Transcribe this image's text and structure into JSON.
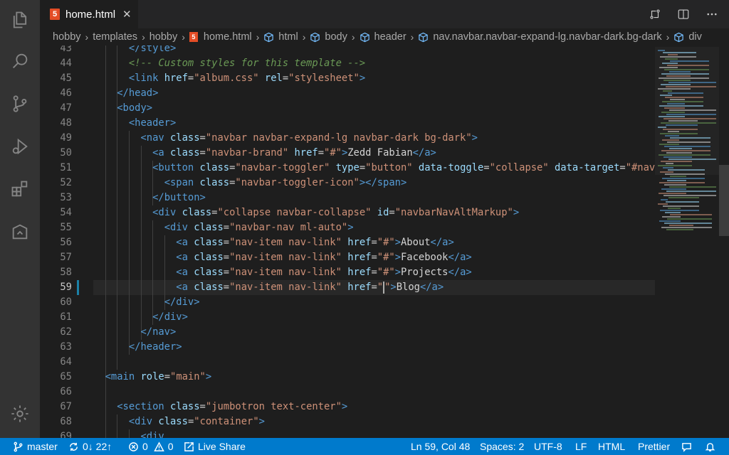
{
  "tab": {
    "icon_label": "5",
    "label": "home.html",
    "close": "✕"
  },
  "breadcrumb": {
    "items": [
      "hobby",
      "templates",
      "hobby",
      "home.html",
      "html",
      "body",
      "header",
      "nav.navbar.navbar-expand-lg.navbar-dark.bg-dark",
      "div"
    ],
    "separator": "›"
  },
  "activity_bar": {
    "items": [
      "explorer-icon",
      "search-icon",
      "source-control-icon",
      "run-debug-icon",
      "extensions-icon",
      "remote-explorer-icon"
    ],
    "bottom": "settings-gear-icon"
  },
  "editor": {
    "current_line": 59,
    "lines": [
      {
        "n": "43",
        "code": [
          [
            "x",
            "      "
          ],
          [
            "t",
            "</style>"
          ]
        ]
      },
      {
        "n": "44",
        "code": [
          [
            "x",
            "      "
          ],
          [
            "c",
            "<!-- Custom styles for this template -->"
          ]
        ]
      },
      {
        "n": "45",
        "code": [
          [
            "x",
            "      "
          ],
          [
            "t",
            "<link "
          ],
          [
            "a",
            "href"
          ],
          [
            "x",
            "="
          ],
          [
            "s",
            "\"album.css\""
          ],
          [
            "x",
            " "
          ],
          [
            "a",
            "rel"
          ],
          [
            "x",
            "="
          ],
          [
            "s",
            "\"stylesheet\""
          ],
          [
            "t",
            ">"
          ]
        ]
      },
      {
        "n": "46",
        "code": [
          [
            "x",
            "    "
          ],
          [
            "t",
            "</head>"
          ]
        ]
      },
      {
        "n": "47",
        "code": [
          [
            "x",
            "    "
          ],
          [
            "t",
            "<body>"
          ]
        ]
      },
      {
        "n": "48",
        "code": [
          [
            "x",
            "      "
          ],
          [
            "t",
            "<header>"
          ]
        ]
      },
      {
        "n": "49",
        "code": [
          [
            "x",
            "        "
          ],
          [
            "t",
            "<nav "
          ],
          [
            "a",
            "class"
          ],
          [
            "x",
            "="
          ],
          [
            "s",
            "\"navbar navbar-expand-lg navbar-dark bg-dark\""
          ],
          [
            "t",
            ">"
          ]
        ]
      },
      {
        "n": "50",
        "code": [
          [
            "x",
            "          "
          ],
          [
            "t",
            "<a "
          ],
          [
            "a",
            "class"
          ],
          [
            "x",
            "="
          ],
          [
            "s",
            "\"navbar-brand\""
          ],
          [
            "x",
            " "
          ],
          [
            "a",
            "href"
          ],
          [
            "x",
            "="
          ],
          [
            "s",
            "\"#\""
          ],
          [
            "t",
            ">"
          ],
          [
            "x",
            "Zedd Fabian"
          ],
          [
            "t",
            "</a>"
          ]
        ]
      },
      {
        "n": "51",
        "code": [
          [
            "x",
            "          "
          ],
          [
            "t",
            "<button "
          ],
          [
            "a",
            "class"
          ],
          [
            "x",
            "="
          ],
          [
            "s",
            "\"navbar-toggler\""
          ],
          [
            "x",
            " "
          ],
          [
            "a",
            "type"
          ],
          [
            "x",
            "="
          ],
          [
            "s",
            "\"button\""
          ],
          [
            "x",
            " "
          ],
          [
            "a",
            "data-toggle"
          ],
          [
            "x",
            "="
          ],
          [
            "s",
            "\"collapse\""
          ],
          [
            "x",
            " "
          ],
          [
            "a",
            "data-target"
          ],
          [
            "x",
            "="
          ],
          [
            "s",
            "\"#navba"
          ]
        ]
      },
      {
        "n": "52",
        "code": [
          [
            "x",
            "            "
          ],
          [
            "t",
            "<span "
          ],
          [
            "a",
            "class"
          ],
          [
            "x",
            "="
          ],
          [
            "s",
            "\"navbar-toggler-icon\""
          ],
          [
            "t",
            "></span>"
          ]
        ]
      },
      {
        "n": "53",
        "code": [
          [
            "x",
            "          "
          ],
          [
            "t",
            "</button>"
          ]
        ]
      },
      {
        "n": "54",
        "code": [
          [
            "x",
            "          "
          ],
          [
            "t",
            "<div "
          ],
          [
            "a",
            "class"
          ],
          [
            "x",
            "="
          ],
          [
            "s",
            "\"collapse navbar-collapse\""
          ],
          [
            "x",
            " "
          ],
          [
            "a",
            "id"
          ],
          [
            "x",
            "="
          ],
          [
            "s",
            "\"navbarNavAltMarkup\""
          ],
          [
            "t",
            ">"
          ]
        ]
      },
      {
        "n": "55",
        "code": [
          [
            "x",
            "            "
          ],
          [
            "t",
            "<div "
          ],
          [
            "a",
            "class"
          ],
          [
            "x",
            "="
          ],
          [
            "s",
            "\"navbar-nav ml-auto\""
          ],
          [
            "t",
            ">"
          ]
        ]
      },
      {
        "n": "56",
        "code": [
          [
            "x",
            "              "
          ],
          [
            "t",
            "<a "
          ],
          [
            "a",
            "class"
          ],
          [
            "x",
            "="
          ],
          [
            "s",
            "\"nav-item nav-link\""
          ],
          [
            "x",
            " "
          ],
          [
            "a",
            "href"
          ],
          [
            "x",
            "="
          ],
          [
            "s",
            "\"#\""
          ],
          [
            "t",
            ">"
          ],
          [
            "x",
            "About"
          ],
          [
            "t",
            "</a>"
          ]
        ]
      },
      {
        "n": "57",
        "code": [
          [
            "x",
            "              "
          ],
          [
            "t",
            "<a "
          ],
          [
            "a",
            "class"
          ],
          [
            "x",
            "="
          ],
          [
            "s",
            "\"nav-item nav-link\""
          ],
          [
            "x",
            " "
          ],
          [
            "a",
            "href"
          ],
          [
            "x",
            "="
          ],
          [
            "s",
            "\"#\""
          ],
          [
            "t",
            ">"
          ],
          [
            "x",
            "Facebook"
          ],
          [
            "t",
            "</a>"
          ]
        ]
      },
      {
        "n": "58",
        "code": [
          [
            "x",
            "              "
          ],
          [
            "t",
            "<a "
          ],
          [
            "a",
            "class"
          ],
          [
            "x",
            "="
          ],
          [
            "s",
            "\"nav-item nav-link\""
          ],
          [
            "x",
            " "
          ],
          [
            "a",
            "href"
          ],
          [
            "x",
            "="
          ],
          [
            "s",
            "\"#\""
          ],
          [
            "t",
            ">"
          ],
          [
            "x",
            "Projects"
          ],
          [
            "t",
            "</a>"
          ]
        ]
      },
      {
        "n": "59",
        "code": [
          [
            "x",
            "              "
          ],
          [
            "t",
            "<a "
          ],
          [
            "a",
            "class"
          ],
          [
            "x",
            "="
          ],
          [
            "s",
            "\""
          ],
          [
            "caret",
            ""
          ],
          [
            "s",
            "\""
          ],
          [
            "t",
            ">"
          ],
          [
            "x",
            "Blog"
          ],
          [
            "t",
            "</a>"
          ]
        ],
        "attr_prefix": "nav-item nav-link"
      },
      {
        "n": "60",
        "code": [
          [
            "x",
            "            "
          ],
          [
            "t",
            "</div>"
          ]
        ]
      },
      {
        "n": "61",
        "code": [
          [
            "x",
            "          "
          ],
          [
            "t",
            "</div>"
          ]
        ]
      },
      {
        "n": "62",
        "code": [
          [
            "x",
            "        "
          ],
          [
            "t",
            "</nav>"
          ]
        ]
      },
      {
        "n": "63",
        "code": [
          [
            "x",
            "      "
          ],
          [
            "t",
            "</header>"
          ]
        ]
      },
      {
        "n": "64",
        "code": []
      },
      {
        "n": "65",
        "code": [
          [
            "x",
            "  "
          ],
          [
            "t",
            "<main "
          ],
          [
            "a",
            "role"
          ],
          [
            "x",
            "="
          ],
          [
            "s",
            "\"main\""
          ],
          [
            "t",
            ">"
          ]
        ]
      },
      {
        "n": "66",
        "code": []
      },
      {
        "n": "67",
        "code": [
          [
            "x",
            "    "
          ],
          [
            "t",
            "<section "
          ],
          [
            "a",
            "class"
          ],
          [
            "x",
            "="
          ],
          [
            "s",
            "\"jumbotron text-center\""
          ],
          [
            "t",
            ">"
          ]
        ]
      },
      {
        "n": "68",
        "code": [
          [
            "x",
            "      "
          ],
          [
            "t",
            "<div "
          ],
          [
            "a",
            "class"
          ],
          [
            "x",
            "="
          ],
          [
            "s",
            "\"container\""
          ],
          [
            "t",
            ">"
          ]
        ]
      },
      {
        "n": "69",
        "code": [
          [
            "x",
            "        "
          ],
          [
            "t",
            "<div"
          ]
        ]
      }
    ]
  },
  "status": {
    "branch": "master",
    "sync": "0↓ 22↑",
    "errors": "0",
    "warnings": "0",
    "live_share": "Live Share",
    "position": "Ln 59, Col 48",
    "spaces": "Spaces: 2",
    "encoding": "UTF-8",
    "eol": "LF",
    "language": "HTML",
    "formatter": "Prettier"
  },
  "colors": {
    "accent": "#007acc",
    "tag": "#569cd6",
    "attr": "#9cdcfe",
    "string": "#ce9178",
    "comment": "#6a9955"
  }
}
